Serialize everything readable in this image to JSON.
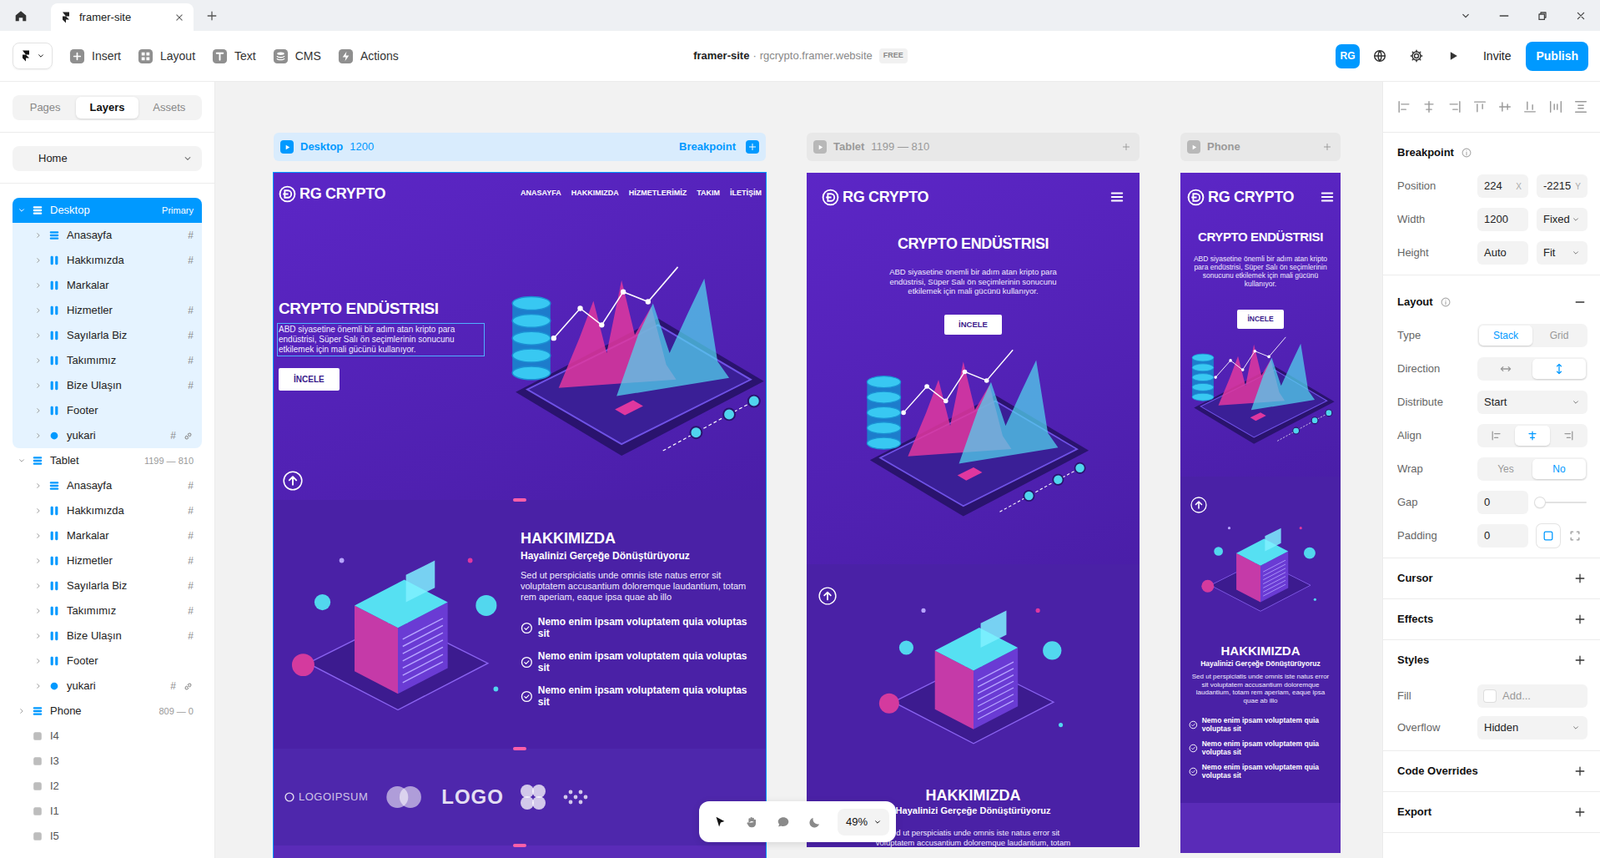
{
  "browser": {
    "tabs": [
      {
        "title": "framer-site",
        "selected": true
      }
    ]
  },
  "toolbar": {
    "menu": [
      {
        "label": "Insert",
        "kind": "insert"
      },
      {
        "label": "Layout",
        "kind": "layout"
      },
      {
        "label": "Text",
        "kind": "text"
      },
      {
        "label": "CMS",
        "kind": "cms"
      },
      {
        "label": "Actions",
        "kind": "actions"
      }
    ],
    "project": "framer-site",
    "separator": "·",
    "domain": "rgcrypto.framer.website",
    "plan": "FREE",
    "avatar": "RG",
    "invite": "Invite",
    "publish": "Publish"
  },
  "sidebar": {
    "tabs": [
      {
        "label": "Pages",
        "selected": false
      },
      {
        "label": "Layers",
        "selected": true
      },
      {
        "label": "Assets",
        "selected": false
      }
    ],
    "page": "Home",
    "layers": [
      {
        "name": "Desktop",
        "kind": "rows",
        "badge": "Primary",
        "expanded": true,
        "selected": true,
        "children": [
          {
            "name": "Anasayfa",
            "kind": "rows",
            "tag": "#",
            "expanded": false,
            "selected": false
          },
          {
            "name": "Hakkımızda",
            "kind": "cols",
            "tag": "#",
            "expanded": false,
            "selected": false
          },
          {
            "name": "Markalar",
            "kind": "cols",
            "expanded": false,
            "selected": false
          },
          {
            "name": "Hizmetler",
            "kind": "cols",
            "tag": "#",
            "expanded": false,
            "selected": false
          },
          {
            "name": "Sayılarla Biz",
            "kind": "cols",
            "tag": "#",
            "expanded": false,
            "selected": false
          },
          {
            "name": "Takımımız",
            "kind": "cols",
            "tag": "#",
            "expanded": false,
            "selected": false
          },
          {
            "name": "Bize Ulaşın",
            "kind": "cols",
            "tag": "#",
            "expanded": false,
            "selected": false
          },
          {
            "name": "Footer",
            "kind": "cols",
            "expanded": false,
            "selected": false
          },
          {
            "name": "yukari",
            "kind": "circle",
            "tag": "#",
            "linked": true,
            "expanded": false,
            "selected": false
          }
        ]
      },
      {
        "name": "Tablet",
        "kind": "rows",
        "range": "1199 — 810",
        "expanded": true,
        "selected": false,
        "children": [
          {
            "name": "Anasayfa",
            "kind": "rows",
            "tag": "#",
            "expanded": false,
            "selected": false
          },
          {
            "name": "Hakkımızda",
            "kind": "cols",
            "tag": "#",
            "expanded": false,
            "selected": false
          },
          {
            "name": "Markalar",
            "kind": "cols",
            "tag": "#",
            "expanded": false,
            "selected": false
          },
          {
            "name": "Hizmetler",
            "kind": "cols",
            "tag": "#",
            "expanded": false,
            "selected": false
          },
          {
            "name": "Sayılarla Biz",
            "kind": "cols",
            "tag": "#",
            "expanded": false,
            "selected": false
          },
          {
            "name": "Takımımız",
            "kind": "cols",
            "tag": "#",
            "expanded": false,
            "selected": false
          },
          {
            "name": "Bize Ulaşın",
            "kind": "cols",
            "tag": "#",
            "expanded": false,
            "selected": false
          },
          {
            "name": "Footer",
            "kind": "cols",
            "expanded": false,
            "selected": false
          },
          {
            "name": "yukari",
            "kind": "circle",
            "tag": "#",
            "linked": true,
            "expanded": false,
            "selected": false
          }
        ]
      },
      {
        "name": "Phone",
        "kind": "rows",
        "range": "809 — 0",
        "expanded": false,
        "selected": false
      },
      {
        "name": "I4",
        "kind": "box",
        "selected": false
      },
      {
        "name": "I3",
        "kind": "box",
        "selected": false
      },
      {
        "name": "I2",
        "kind": "box",
        "selected": false
      },
      {
        "name": "I1",
        "kind": "box",
        "selected": false
      },
      {
        "name": "I5",
        "kind": "box",
        "selected": false
      }
    ]
  },
  "canvas": {
    "frames": [
      {
        "name": "Desktop",
        "size": "1200",
        "action": "Breakpoint",
        "selected": true,
        "kind": "desktop",
        "site": {
          "logo": "RG CRYPTO",
          "nav": [
            "ANASAYFA",
            "HAKKIMIZDA",
            "HİZMETLERİMİZ",
            "TAKIM",
            "İLETİŞİM"
          ],
          "hero": {
            "title": "CRYPTO ENDÜSTRISI",
            "text": "ABD siyasetine önemli bir adım atan kripto para endüstrisi, Süper Salı ön seçimlerinin sonucunu etkilemek için mali gücünü kullanıyor.",
            "button": "İNCELE"
          },
          "about": {
            "title": "HAKKIMIZDA",
            "subtitle": "Hayalinizi Gerçeğe Dönüştürüyoruz",
            "text": "Sed ut perspiciatis unde omnis iste natus error sit voluptatem accusantium doloremque laudantium, totam rem aperiam, eaque ipsa quae ab illo",
            "points": [
              "Nemo enim ipsam voluptatem quia voluptas sit",
              "Nemo enim ipsam voluptatem quia voluptas sit",
              "Nemo enim ipsam voluptatem quia voluptas sit"
            ]
          },
          "brands": [
            "LOGOIPSUM",
            "LOGO"
          ]
        }
      },
      {
        "name": "Tablet",
        "size": "1199 — 810",
        "selected": false,
        "kind": "tablet",
        "site": {
          "logo": "RG CRYPTO",
          "hero": {
            "title": "CRYPTO ENDÜSTRISI",
            "text": "ABD siyasetine önemli bir adım atan kripto para endüstrisi, Süper Salı ön seçimlerinin sonucunu etkilemek için mali gücünü kullanıyor.",
            "button": "İNCELE"
          },
          "about": {
            "title": "HAKKIMIZDA",
            "subtitle": "Hayalinizi Gerçeğe Dönüştürüyoruz",
            "text": "Sed ut perspiciatis unde omnis iste natus error sit voluptatem accusantium doloremque laudantium, totam"
          }
        }
      },
      {
        "name": "Phone",
        "selected": false,
        "kind": "phone",
        "site": {
          "logo": "RG CRYPTO",
          "hero": {
            "title": "CRYPTO ENDÜSTRISI",
            "text": "ABD siyasetine önemli bir adım atan kripto para endüstrisi, Süper Salı ön seçimlerinin sonucunu etkilemek için mali gücünü kullanıyor.",
            "button": "İNCELE"
          },
          "about": {
            "title": "HAKKIMIZDA",
            "subtitle": "Hayalinizi Gerçeğe Dönüştürüyoruz",
            "text": "Sed ut perspiciatis unde omnis iste natus error sit voluptatem accusantium doloremque laudantium, totam rem aperiam, eaque ipsa quae ab illo",
            "points": [
              "Nemo enim ipsam voluptatem quia voluptas sit",
              "Nemo enim ipsam voluptatem quia voluptas sit",
              "Nemo enim ipsam voluptatem quia voluptas sit"
            ]
          }
        }
      }
    ],
    "floatbar": {
      "tools": [
        {
          "kind": "select",
          "selected": true
        },
        {
          "kind": "hand",
          "selected": false
        },
        {
          "kind": "comment",
          "selected": false
        },
        {
          "kind": "theme",
          "selected": false
        }
      ],
      "zoom": "49%"
    }
  },
  "inspector": {
    "breakpoint": {
      "title": "Breakpoint",
      "position": {
        "label": "Position",
        "x": "224",
        "x_axis": "X",
        "y": "-2215",
        "y_axis": "Y"
      },
      "width": {
        "label": "Width",
        "value": "1200",
        "mode": "Fixed"
      },
      "height": {
        "label": "Height",
        "value": "Auto",
        "mode": "Fit"
      }
    },
    "layout": {
      "title": "Layout",
      "expanded": true,
      "type": {
        "label": "Type",
        "options": [
          {
            "label": "Stack",
            "selected": true
          },
          {
            "label": "Grid",
            "selected": false
          }
        ]
      },
      "direction": {
        "label": "Direction",
        "options": [
          {
            "kind": "horizontal",
            "selected": false
          },
          {
            "kind": "vertical",
            "selected": true
          }
        ]
      },
      "distribute": {
        "label": "Distribute",
        "value": "Start"
      },
      "align": {
        "label": "Align",
        "options": [
          {
            "kind": "start",
            "selected": false
          },
          {
            "kind": "center",
            "selected": true
          },
          {
            "kind": "end",
            "selected": false
          }
        ]
      },
      "wrap": {
        "label": "Wrap",
        "options": [
          {
            "label": "Yes",
            "selected": false
          },
          {
            "label": "No",
            "selected": true
          }
        ]
      },
      "gap": {
        "label": "Gap",
        "value": "0",
        "level": 0
      },
      "padding": {
        "label": "Padding",
        "value": "0",
        "options": [
          {
            "kind": "uniform",
            "selected": true
          },
          {
            "kind": "individual",
            "selected": false
          }
        ]
      }
    },
    "sections": [
      {
        "title": "Cursor"
      },
      {
        "title": "Effects"
      },
      {
        "title": "Styles",
        "fields": [
          {
            "label": "Fill",
            "value": "Add...",
            "kind": "fill"
          },
          {
            "label": "Overflow",
            "value": "Hidden",
            "kind": "select"
          }
        ]
      },
      {
        "title": "Code Overrides"
      },
      {
        "title": "Export"
      }
    ]
  }
}
